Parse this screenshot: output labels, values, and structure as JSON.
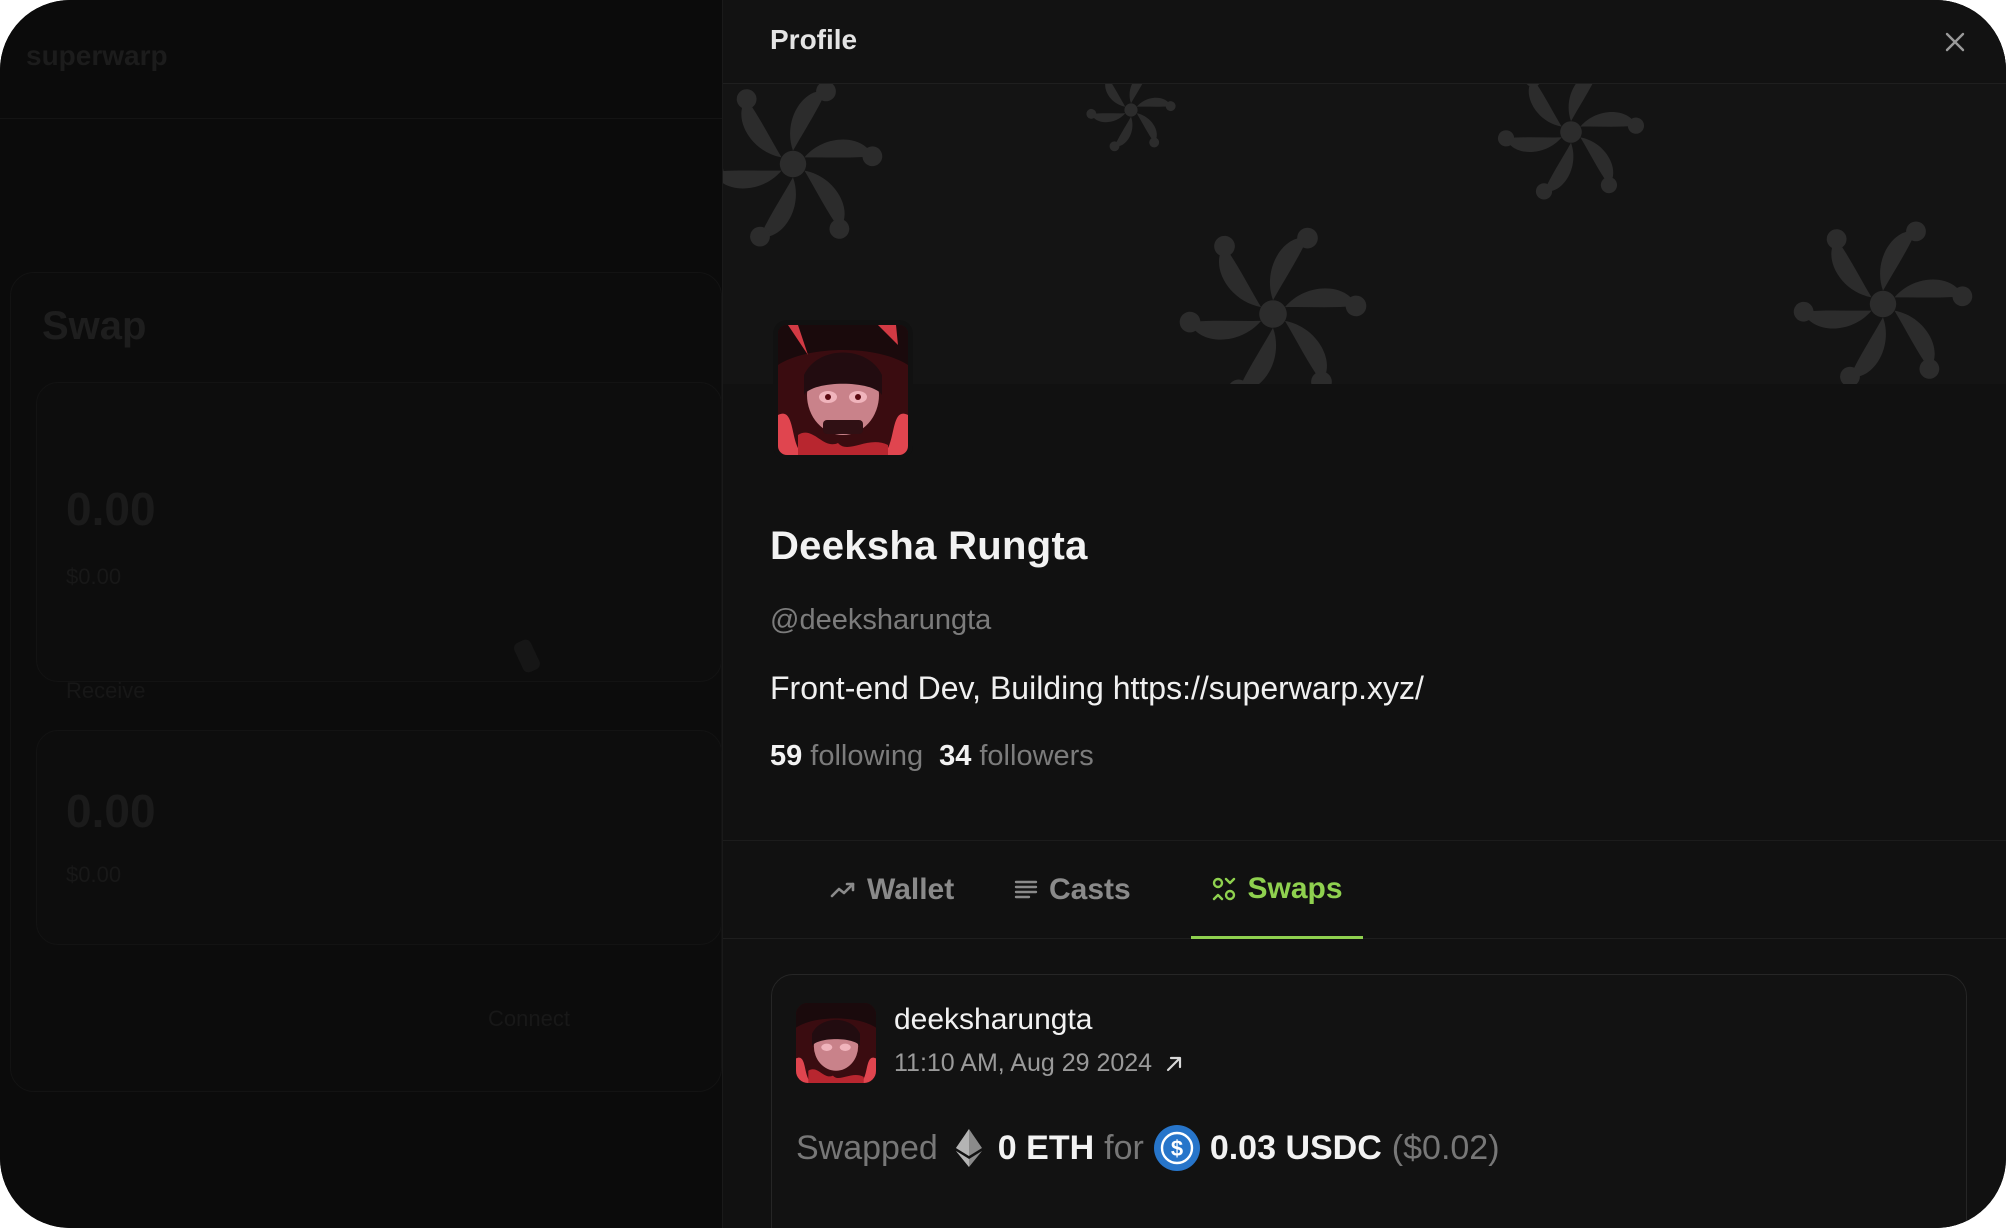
{
  "background_app": {
    "logo": "superwarp",
    "card_title": "Swap",
    "from_amount": "0.00",
    "from_sub": "$0.00",
    "receive_label": "Receive",
    "to_amount": "0.00",
    "to_sub": "$0.00",
    "connect_label": "Connect"
  },
  "panel": {
    "title": "Profile",
    "close_icon": "close-icon"
  },
  "profile": {
    "display_name": "Deeksha Rungta",
    "handle": "@deeksharungta",
    "bio": "Front-end Dev, Building https://superwarp.xyz/",
    "following_count": "59",
    "following_label": "following",
    "followers_count": "34",
    "followers_label": "followers"
  },
  "tabs": [
    {
      "label": "Wallet",
      "icon": "trend-up-icon",
      "active": false
    },
    {
      "label": "Casts",
      "icon": "list-icon",
      "active": false
    },
    {
      "label": "Swaps",
      "icon": "swap-icon",
      "active": true
    }
  ],
  "swap_item": {
    "username": "deeksharungta",
    "timestamp": "11:10 AM, Aug 29 2024",
    "action": "Swapped",
    "from_amount": "0 ETH",
    "connector": "for",
    "to_amount": "0.03 USDC",
    "to_value": "($0.02)"
  },
  "colors": {
    "accent": "#8fd14f",
    "panel_bg": "#111111",
    "muted_text": "#7c7c7c",
    "usdc_blue": "#2775ca"
  }
}
